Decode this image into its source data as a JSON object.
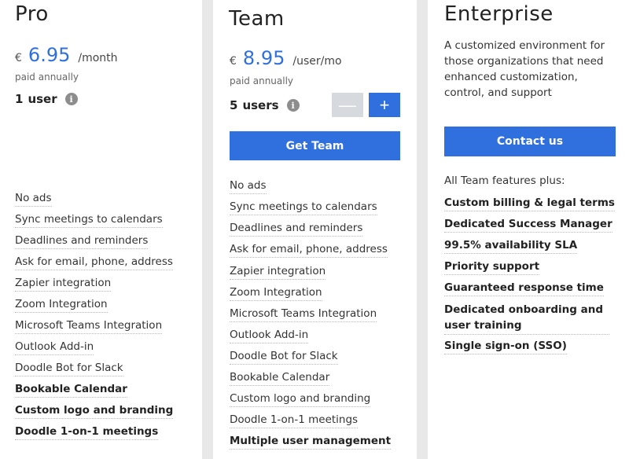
{
  "pro": {
    "name": "Pro",
    "currency": "€",
    "price": "6.95",
    "period": "/month",
    "billing": "paid annually",
    "users_count": "1",
    "users_label": "user",
    "features": [
      {
        "text": "No ads",
        "bold": false
      },
      {
        "text": "Sync meetings to calendars",
        "bold": false
      },
      {
        "text": "Deadlines and reminders",
        "bold": false
      },
      {
        "text": "Ask for email, phone, address",
        "bold": false
      },
      {
        "text": "Zapier integration",
        "bold": false
      },
      {
        "text": "Zoom Integration",
        "bold": false
      },
      {
        "text": "Microsoft Teams Integration",
        "bold": false
      },
      {
        "text": "Outlook Add-in",
        "bold": false
      },
      {
        "text": "Doodle Bot for Slack",
        "bold": false
      },
      {
        "text": "Bookable Calendar",
        "bold": true
      },
      {
        "text": "Custom logo and branding",
        "bold": true
      },
      {
        "text": "Doodle 1-on-1 meetings",
        "bold": true
      }
    ]
  },
  "team": {
    "name": "Team",
    "currency": "€",
    "price": "8.95",
    "period": "/user/mo",
    "billing": "paid annually",
    "users_count": "5",
    "users_label": "users",
    "minus_symbol": "—",
    "plus_symbol": "+",
    "cta": "Get Team",
    "features": [
      {
        "text": "No ads",
        "bold": false
      },
      {
        "text": "Sync meetings to calendars",
        "bold": false
      },
      {
        "text": "Deadlines and reminders",
        "bold": false
      },
      {
        "text": "Ask for email, phone, address",
        "bold": false
      },
      {
        "text": "Zapier integration",
        "bold": false
      },
      {
        "text": "Zoom Integration",
        "bold": false
      },
      {
        "text": "Microsoft Teams Integration",
        "bold": false
      },
      {
        "text": "Outlook Add-in",
        "bold": false
      },
      {
        "text": "Doodle Bot for Slack",
        "bold": false
      },
      {
        "text": "Bookable Calendar",
        "bold": false
      },
      {
        "text": "Custom logo and branding",
        "bold": false
      },
      {
        "text": "Doodle 1-on-1 meetings",
        "bold": false
      },
      {
        "text": "Multiple user management",
        "bold": true
      }
    ]
  },
  "enterprise": {
    "name": "Enterprise",
    "description": "A customized environment for those organizations that need enhanced customization, control, and support",
    "cta": "Contact us",
    "lead": "All Team features plus:",
    "features": [
      {
        "text": "Custom billing & legal terms",
        "bold": true
      },
      {
        "text": "Dedicated Success Manager",
        "bold": true
      },
      {
        "text": "99.5% availability SLA",
        "bold": true
      },
      {
        "text": "Priority support",
        "bold": true
      },
      {
        "text": "Guaranteed response time",
        "bold": true
      },
      {
        "text": "Dedicated onboarding and user training",
        "bold": true
      },
      {
        "text": "Single sign-on (SSO)",
        "bold": true
      }
    ]
  },
  "info_glyph": "i",
  "colors": {
    "accent": "#2f6fde",
    "disabled": "#d6dade"
  }
}
